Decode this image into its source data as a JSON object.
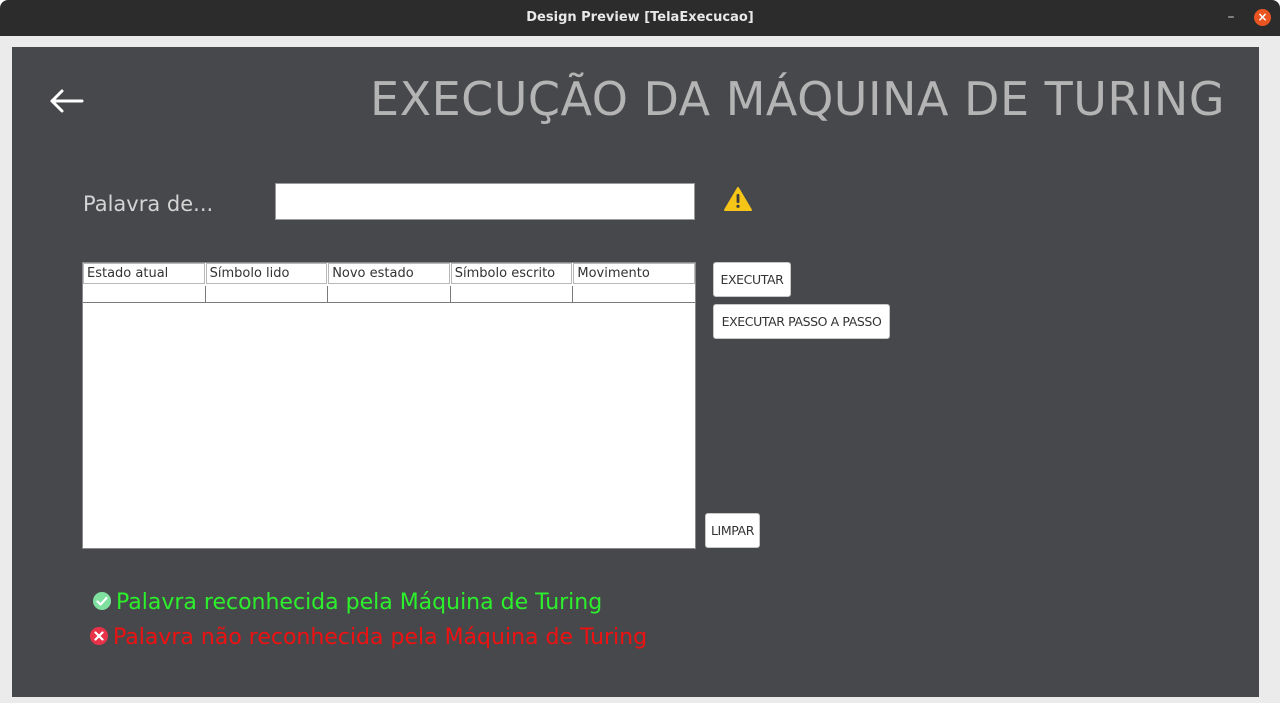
{
  "window": {
    "title": "Design Preview [TelaExecucao]",
    "min_glyph": "–",
    "close_glyph": "×"
  },
  "page": {
    "title": "EXECUÇÃO DA MÁQUINA DE TURING",
    "back_icon": "left-arrow-icon"
  },
  "word": {
    "label": "Palavra de...",
    "value": "",
    "placeholder": "",
    "warning_icon": "warning-icon"
  },
  "table": {
    "columns": [
      "Estado atual",
      "Símbolo lido",
      "Novo estado",
      "Símbolo escrito",
      "Movimento"
    ],
    "rows": [
      [
        "",
        "",
        "",
        "",
        ""
      ]
    ]
  },
  "buttons": {
    "execute": "EXECUTAR",
    "step": "EXECUTAR PASSO A PASSO",
    "clear": "LIMPAR"
  },
  "status": {
    "accepted": "Palavra reconhecida pela Máquina de Turing",
    "rejected": "Palavra não reconhecida pela Máquina de Turing"
  },
  "colors": {
    "background": "#47484b",
    "title_text": "#b4b4b4",
    "accepted": "#2cf02c",
    "rejected": "#ee1111",
    "close_button": "#e95420"
  }
}
